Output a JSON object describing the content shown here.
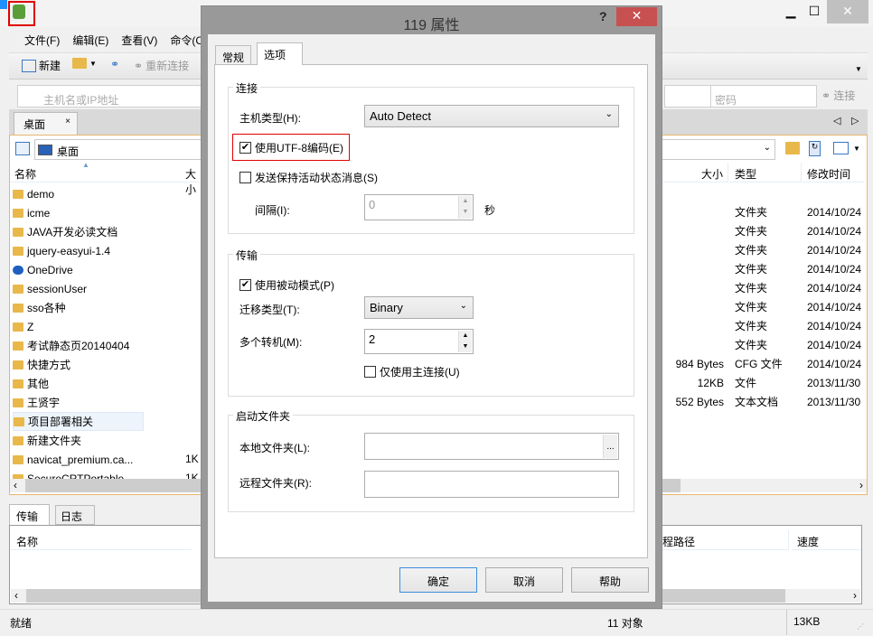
{
  "main_window": {
    "menu": [
      "文件(F)",
      "编辑(E)",
      "查看(V)",
      "命令(C)"
    ],
    "toolbar": {
      "new_label": "新建",
      "reconnect_label": "重新连接",
      "connect_label": "连接"
    },
    "host_placeholder": "主机名或IP地址",
    "password_placeholder": "密码",
    "file_tab": "桌面",
    "path": "桌面",
    "columns": {
      "name": "名称",
      "size": "大小",
      "type": "类型",
      "modified": "修改时间"
    },
    "files": [
      {
        "name": "demo"
      },
      {
        "name": "icme",
        "type": "文件夹",
        "modified": "2014/10/24"
      },
      {
        "name": "JAVA开发必读文档",
        "type": "文件夹",
        "modified": "2014/10/24"
      },
      {
        "name": "jquery-easyui-1.4",
        "type": "文件夹",
        "modified": "2014/10/24"
      },
      {
        "name": "OneDrive",
        "type": "文件夹",
        "modified": "2014/10/24"
      },
      {
        "name": "sessionUser",
        "type": "文件夹",
        "modified": "2014/10/24"
      },
      {
        "name": "sso各种",
        "type": "文件夹",
        "modified": "2014/10/24"
      },
      {
        "name": "Z",
        "type": "文件夹",
        "modified": "2014/10/24"
      },
      {
        "name": "考试静态页20140404",
        "type": "文件夹",
        "modified": "2014/10/24"
      },
      {
        "name": "快捷方式",
        "size": "984 Bytes",
        "type": "CFG 文件",
        "modified": "2014/10/24"
      },
      {
        "name": "其他",
        "size": "12KB",
        "type": "文件",
        "modified": "2013/11/30"
      },
      {
        "name": "王贤宇",
        "size": "552 Bytes",
        "type": "文本文档",
        "modified": "2013/11/30"
      },
      {
        "name": "项目部署相关"
      },
      {
        "name": "新建文件夹"
      },
      {
        "name": "navicat_premium.ca...",
        "size": "1K"
      },
      {
        "name": "SecureCRTPortable",
        "size": "1K"
      }
    ],
    "lower_tabs": [
      "传输",
      "日志"
    ],
    "transfer_columns": {
      "name": "名称",
      "remote_path": "远程路径",
      "speed": "速度"
    },
    "status": {
      "text": "就绪",
      "objects": "11 对象",
      "size": "13KB"
    }
  },
  "dialog": {
    "title": "119 属性",
    "help": "?",
    "tabs": [
      "常规",
      "选项"
    ],
    "connection": {
      "legend": "连接",
      "host_type_label": "主机类型(H):",
      "host_type_value": "Auto Detect",
      "utf8_label": "使用UTF-8编码(E)",
      "utf8_checked": true,
      "keepalive_label": "发送保持活动状态消息(S)",
      "keepalive_checked": false,
      "interval_label": "间隔(I):",
      "interval_value": "0",
      "interval_unit": "秒"
    },
    "transfer": {
      "legend": "传输",
      "passive_label": "使用被动模式(P)",
      "passive_checked": true,
      "mode_label": "迁移类型(T):",
      "mode_value": "Binary",
      "multi_label": "多个转机(M):",
      "multi_value": "2",
      "main_only_label": "仅使用主连接(U)",
      "main_only_checked": false
    },
    "startup": {
      "legend": "启动文件夹",
      "local_label": "本地文件夹(L):",
      "local_value": "",
      "browse": "...",
      "remote_label": "远程文件夹(R):",
      "remote_value": ""
    },
    "buttons": {
      "ok": "确定",
      "cancel": "取消",
      "help": "帮助"
    }
  },
  "colors": {
    "highlight": "#e00000",
    "close": "#c75050",
    "pane_border": "#e8b66e"
  }
}
